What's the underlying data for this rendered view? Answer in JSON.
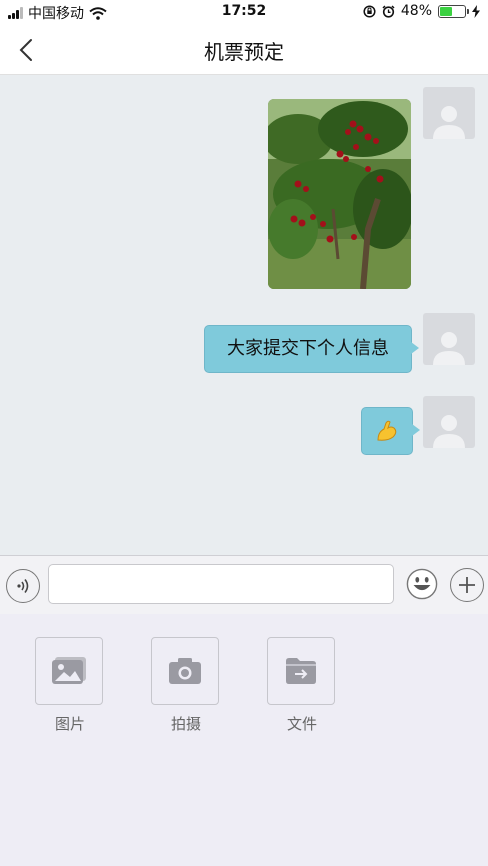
{
  "status_bar": {
    "carrier": "中国移动",
    "time": "17:52",
    "battery_percent": "48%",
    "battery_level": 0.48
  },
  "header": {
    "title": "机票预定"
  },
  "messages": [
    {
      "type": "image",
      "sender": "me"
    },
    {
      "type": "text",
      "sender": "me",
      "text": "大家提交下个人信息"
    },
    {
      "type": "emoji",
      "sender": "me",
      "text": "💪"
    }
  ],
  "input_bar": {
    "value": "",
    "placeholder": ""
  },
  "tools": [
    {
      "label": "图片",
      "icon": "image-icon"
    },
    {
      "label": "拍摄",
      "icon": "camera-icon"
    },
    {
      "label": "文件",
      "icon": "folder-icon"
    }
  ],
  "colors": {
    "bubble": "#7fcadb",
    "battery": "#3bd141",
    "chat_background": "#e9edf0"
  }
}
